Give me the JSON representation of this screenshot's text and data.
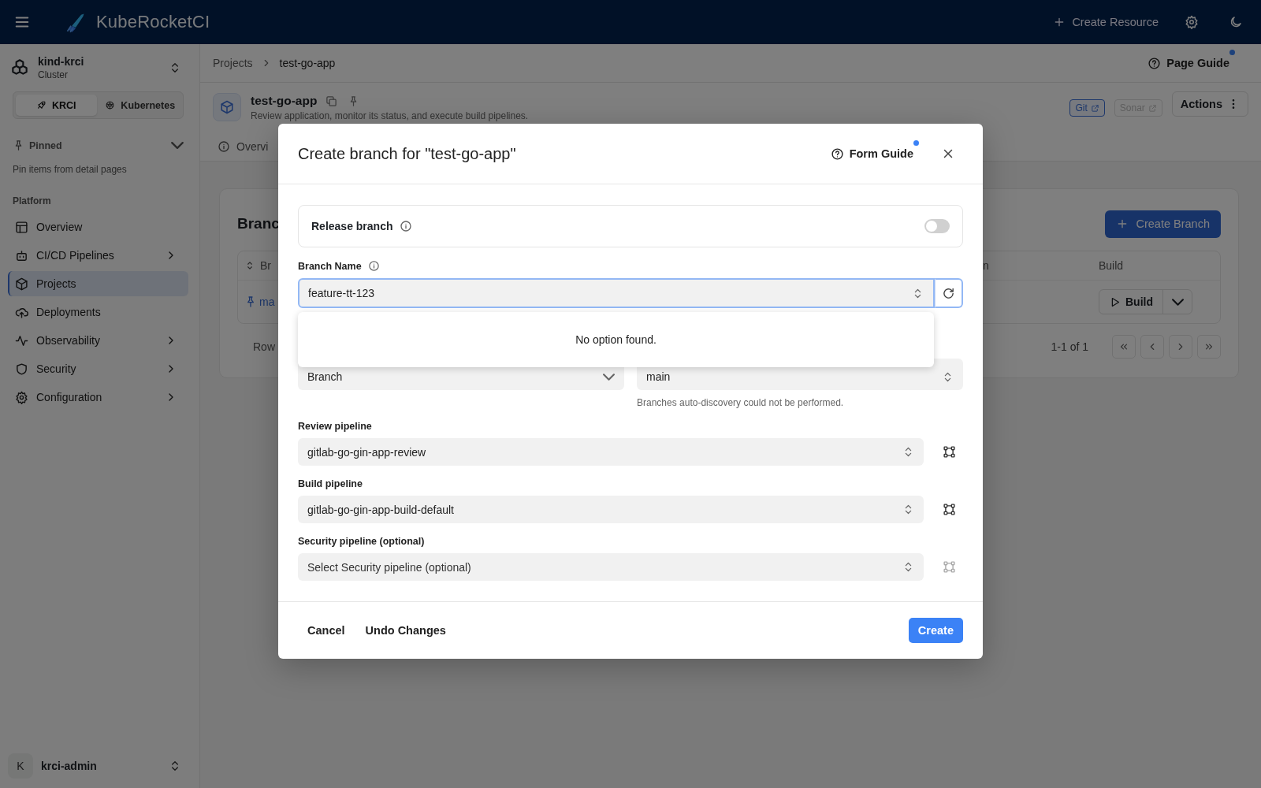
{
  "topbar": {
    "logo_text": "KubeRocketCI",
    "create_label": "Create Resource"
  },
  "cluster": {
    "name": "kind-krci",
    "caption": "Cluster"
  },
  "mode_switch": [
    {
      "label": "KRCI",
      "selected": true
    },
    {
      "label": "Kubernetes",
      "selected": false
    }
  ],
  "pinned": {
    "title": "Pinned",
    "expanded": true,
    "empty_text": "Pin items from detail pages"
  },
  "nav": {
    "section": "Platform",
    "items": [
      {
        "label": "Overview",
        "kind": "link",
        "selected": false
      },
      {
        "label": "CI/CD Pipelines",
        "kind": "group",
        "selected": false
      },
      {
        "label": "Projects",
        "kind": "link",
        "selected": true
      },
      {
        "label": "Deployments",
        "kind": "link",
        "selected": false
      },
      {
        "label": "Observability",
        "kind": "group",
        "selected": false
      },
      {
        "label": "Security",
        "kind": "group",
        "selected": false
      },
      {
        "label": "Configuration",
        "kind": "group",
        "selected": false
      }
    ]
  },
  "user": {
    "initial": "K",
    "name": "krci-admin"
  },
  "breadcrumbs": [
    "Projects",
    "test-go-app"
  ],
  "page_guide": {
    "label": "Page Guide",
    "dot": true
  },
  "project": {
    "name": "test-go-app",
    "description": "Review application, monitor its status, and execute build pipelines.",
    "links": [
      {
        "label": "Git",
        "disabled": false
      },
      {
        "label": "Sonar",
        "disabled": true
      }
    ],
    "actions_label": "Actions"
  },
  "tabs": [
    {
      "label": "Overvi"
    }
  ],
  "branches_card": {
    "title": "Branc",
    "create_label": "Create Branch",
    "columns": [
      "Br",
      "n",
      "Build"
    ],
    "rows": [
      {
        "name": "ma",
        "build_label": "Build"
      }
    ],
    "footer_label": "Row",
    "range": "1-1 of 1"
  },
  "dialog": {
    "title": "Create branch for \"test-go-app\"",
    "guide": {
      "label": "Form Guide",
      "dot": true
    },
    "release": {
      "label": "Release branch",
      "on": false
    },
    "branch_name": {
      "label": "Branch Name",
      "value": "feature-tt-123",
      "menu_message": "No option found."
    },
    "from_fields": [
      {
        "kind": "type",
        "value": "Branch"
      },
      {
        "kind": "ref",
        "value": "main",
        "hint": "Branches auto-discovery could not be performed."
      }
    ],
    "pipelines": [
      {
        "label": "Review pipeline",
        "value": "gitlab-go-gin-app-review",
        "disabled": false
      },
      {
        "label": "Build pipeline",
        "value": "gitlab-go-gin-app-build-default",
        "disabled": false
      },
      {
        "label": "Security pipeline (optional)",
        "placeholder": "Select Security pipeline (optional)",
        "disabled": true
      }
    ],
    "buttons": [
      {
        "label": "Cancel",
        "kind": "text"
      },
      {
        "label": "Undo Changes",
        "kind": "text"
      },
      {
        "label": "Create",
        "kind": "primary"
      }
    ]
  }
}
